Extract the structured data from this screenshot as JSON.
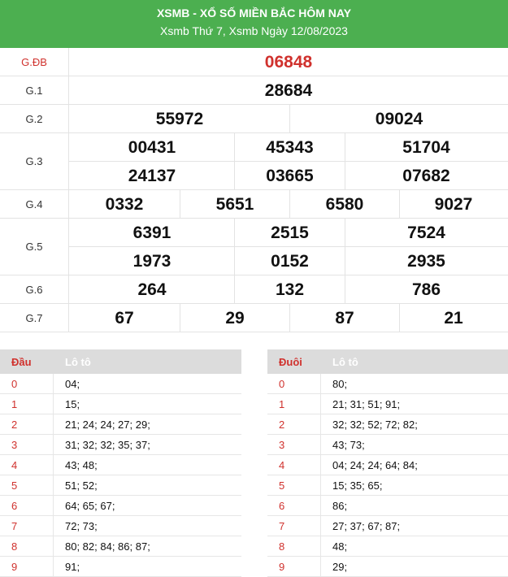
{
  "header": {
    "title": "XSMB - XỔ SỐ MIỀN BẮC HÔM NAY",
    "subtitle": "Xsmb Thứ 7, Xsmb Ngày 12/08/2023"
  },
  "prizes": {
    "db": {
      "label": "G.ĐB",
      "numbers": [
        "06848"
      ]
    },
    "g1": {
      "label": "G.1",
      "numbers": [
        "28684"
      ]
    },
    "g2": {
      "label": "G.2",
      "numbers": [
        "55972",
        "09024"
      ]
    },
    "g3": {
      "label": "G.3",
      "numbers": [
        "00431",
        "45343",
        "51704",
        "24137",
        "03665",
        "07682"
      ]
    },
    "g4": {
      "label": "G.4",
      "numbers": [
        "0332",
        "5651",
        "6580",
        "9027"
      ]
    },
    "g5": {
      "label": "G.5",
      "numbers": [
        "6391",
        "2515",
        "7524",
        "1973",
        "0152",
        "2935"
      ]
    },
    "g6": {
      "label": "G.6",
      "numbers": [
        "264",
        "132",
        "786"
      ]
    },
    "g7": {
      "label": "G.7",
      "numbers": [
        "67",
        "29",
        "87",
        "21"
      ]
    }
  },
  "dau_table": {
    "head_col": "Đầu",
    "lo_col": "Lô tô",
    "rows": [
      {
        "k": "0",
        "v": "04;"
      },
      {
        "k": "1",
        "v": "15;"
      },
      {
        "k": "2",
        "v": "21; 24; 24; 27; 29;"
      },
      {
        "k": "3",
        "v": "31; 32; 32; 35; 37;"
      },
      {
        "k": "4",
        "v": "43; 48;"
      },
      {
        "k": "5",
        "v": "51; 52;"
      },
      {
        "k": "6",
        "v": "64; 65; 67;"
      },
      {
        "k": "7",
        "v": "72; 73;"
      },
      {
        "k": "8",
        "v": "80; 82; 84; 86; 87;"
      },
      {
        "k": "9",
        "v": "91;"
      }
    ]
  },
  "duoi_table": {
    "head_col": "Đuôi",
    "lo_col": "Lô tô",
    "rows": [
      {
        "k": "0",
        "v": "80;"
      },
      {
        "k": "1",
        "v": "21; 31; 51; 91;"
      },
      {
        "k": "2",
        "v": "32; 32; 52; 72; 82;"
      },
      {
        "k": "3",
        "v": "43; 73;"
      },
      {
        "k": "4",
        "v": "04; 24; 24; 64; 84;"
      },
      {
        "k": "5",
        "v": "15; 35; 65;"
      },
      {
        "k": "6",
        "v": "86;"
      },
      {
        "k": "7",
        "v": "27; 37; 67; 87;"
      },
      {
        "k": "8",
        "v": "48;"
      },
      {
        "k": "9",
        "v": "29;"
      }
    ]
  },
  "colors": {
    "header_bg": "#4caf50",
    "accent_red": "#d0312d",
    "table_head_bg": "#dcdcdc"
  }
}
